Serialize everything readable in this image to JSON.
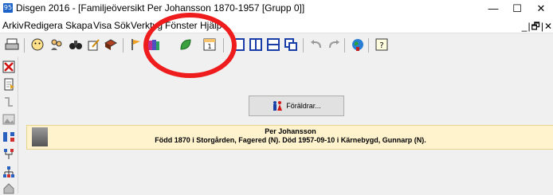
{
  "window": {
    "app_icon_text": "95",
    "title": "Disgen 2016 - [Familjeöversikt Per Johansson 1870-1957 [Grupp 0]]",
    "minimize_glyph": "—",
    "maximize_glyph": "☐",
    "close_glyph": "✕"
  },
  "menu": {
    "items": [
      "Arkiv",
      "Redigera",
      "Skapa",
      "Visa",
      "Sök",
      "Verktyg",
      "Fönster",
      "Hjälp"
    ],
    "mdi_controls": "_|🗗|✕"
  },
  "toolbar": {
    "icons": [
      "printer-icon",
      "person-add-icon",
      "persons-icon",
      "binoculars-icon",
      "edit-notes-icon",
      "book-icon",
      "flag-icon",
      "books-icon",
      "leaf-icon",
      "calendar-icon",
      "layout-1-icon",
      "layout-2-icon",
      "layout-3-icon",
      "layout-4-icon",
      "undo-icon",
      "redo-icon",
      "globe-icon",
      "help-icon"
    ],
    "calendar_text": "1"
  },
  "lefttool": {
    "icons": [
      "close-red-icon",
      "document-icon",
      "merge-icon",
      "image-icon",
      "pedigree-icon",
      "descendants-icon",
      "tree-icon",
      "home-icon"
    ]
  },
  "main": {
    "parents_button": "Föräldrar...",
    "person": {
      "name": "Per Johansson",
      "info": "Född 1870 i Storgården, Fagered (N). Död 1957-09-10 i Kärnebygd, Gunnarp (N)."
    }
  },
  "annotation_color": "#ee1c1c"
}
